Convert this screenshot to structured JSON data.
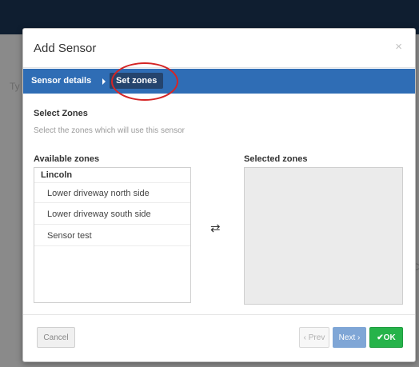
{
  "background": {
    "fragment_left": "Ty",
    "fragment_right": "C"
  },
  "modal": {
    "title": "Add Sensor",
    "close_glyph": "×"
  },
  "wizard": {
    "steps": [
      {
        "label": "Sensor details"
      },
      {
        "label": "Set zones",
        "active": true
      }
    ]
  },
  "section": {
    "title": "Select Zones",
    "description": "Select the zones which will use this sensor"
  },
  "available": {
    "label": "Available zones",
    "group": "Lincoln",
    "items": [
      "Lower driveway north side",
      "Lower driveway south side",
      "Sensor test"
    ]
  },
  "selected": {
    "label": "Selected zones",
    "items": []
  },
  "transfer_glyph": "⇄",
  "buttons": {
    "cancel": "Cancel",
    "prev": "‹ Prev",
    "next": "Next ›",
    "ok": "✔OK"
  },
  "colors": {
    "wizard_bar": "#2f6db5",
    "active_step": "#25446d",
    "ok_button": "#26b34a",
    "highlight": "#d52525"
  }
}
